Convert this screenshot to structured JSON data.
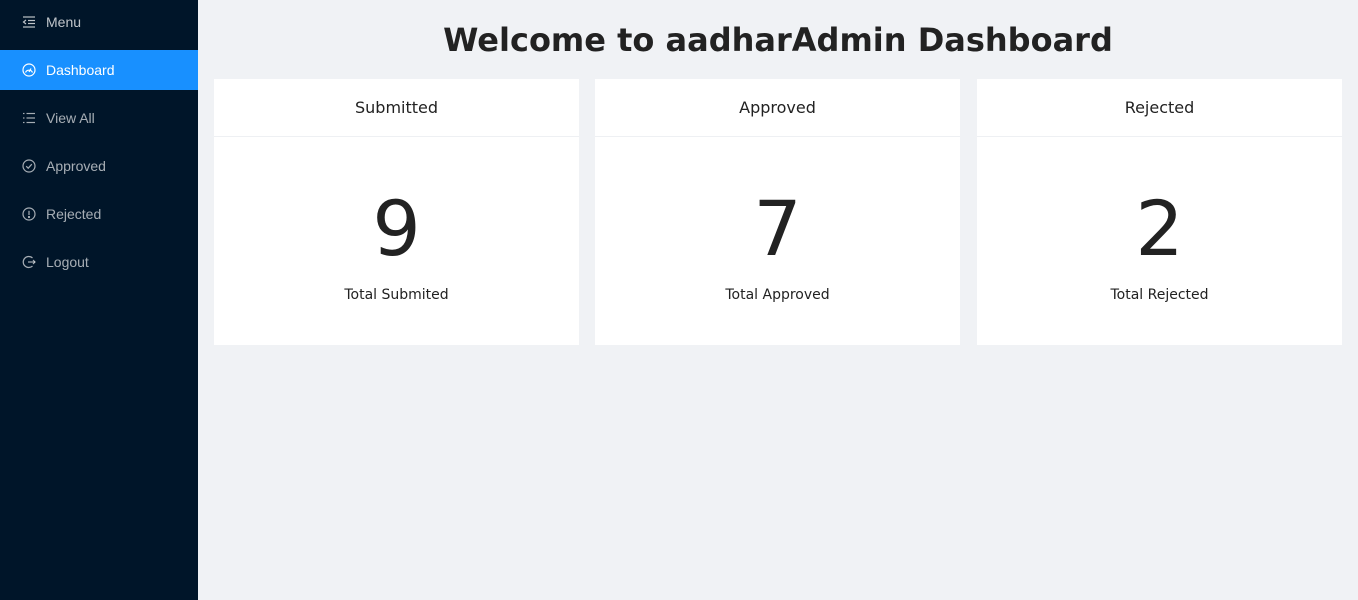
{
  "sidebar": {
    "menu_label": "Menu",
    "items": [
      {
        "label": "Dashboard",
        "icon": "dashboard-icon",
        "active": true
      },
      {
        "label": "View All",
        "icon": "list-icon"
      },
      {
        "label": "Approved",
        "icon": "check-circle-icon"
      },
      {
        "label": "Rejected",
        "icon": "exclamation-circle-icon"
      },
      {
        "label": "Logout",
        "icon": "logout-icon"
      }
    ]
  },
  "main": {
    "title": "Welcome to aadharAdmin Dashboard",
    "cards": [
      {
        "title": "Submitted",
        "value": "9",
        "label": "Total Submited"
      },
      {
        "title": "Approved",
        "value": "7",
        "label": "Total Approved"
      },
      {
        "title": "Rejected",
        "value": "2",
        "label": "Total Rejected"
      }
    ]
  },
  "colors": {
    "sidebar_bg": "#001529",
    "active_bg": "#1890ff",
    "page_bg": "#f0f2f5",
    "card_bg": "#ffffff"
  }
}
